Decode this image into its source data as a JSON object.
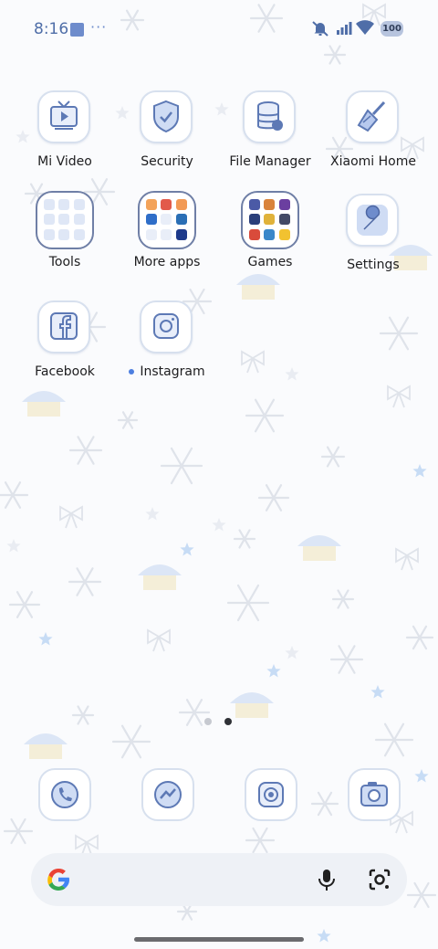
{
  "status_bar": {
    "time": "8:16",
    "overflow": "···",
    "battery": "100",
    "icons": [
      "notification-icon",
      "mute-icon",
      "signal-icon",
      "wifi-icon",
      "battery-icon"
    ]
  },
  "apps": [
    {
      "label": "Mi Video",
      "icon": "tv-icon"
    },
    {
      "label": "Security",
      "icon": "shield-check-icon"
    },
    {
      "label": "File Manager",
      "icon": "database-icon"
    },
    {
      "label": "Xiaomi Home",
      "icon": "broom-icon"
    },
    {
      "label": "Tools",
      "type": "folder"
    },
    {
      "label": "More apps",
      "type": "folder"
    },
    {
      "label": "Games",
      "type": "folder"
    },
    {
      "label": "Settings",
      "icon": "wrench-icon"
    },
    {
      "label": "Facebook",
      "icon": "facebook-icon"
    },
    {
      "label": "Instagram",
      "icon": "instagram-icon",
      "notification": true
    }
  ],
  "page_indicator": {
    "pages": 2,
    "current": 2
  },
  "dock": [
    "phone-icon",
    "messenger-icon",
    "chrome-icon",
    "camera-icon"
  ],
  "search_bar": {
    "left_icon": "google-icon",
    "right_icons": [
      "mic-icon",
      "lens-icon"
    ]
  },
  "colors": {
    "accent": "#6e8ccc",
    "text": "#1d1d1f",
    "icon_border": "#d7e0ee"
  }
}
